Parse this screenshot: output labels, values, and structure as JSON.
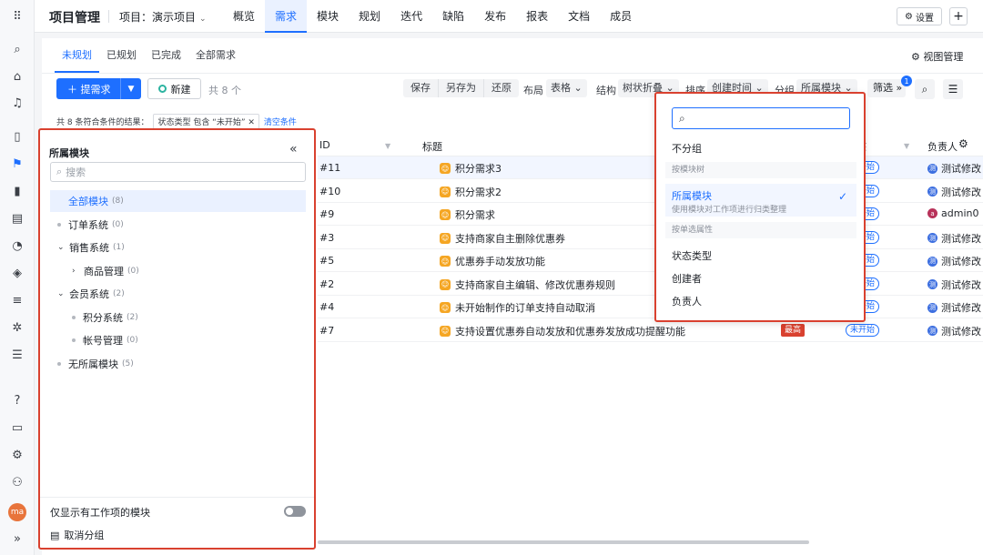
{
  "rail": {
    "icons": [
      "apps-grid-icon",
      "search-icon",
      "home-icon",
      "bell-icon",
      "document-icon",
      "project-icon",
      "chart-icon",
      "knowledge-icon",
      "gauge-icon",
      "cube-icon",
      "test-icon",
      "bug-icon",
      "checklist-icon",
      "help-icon",
      "inbox-icon",
      "gear-icon",
      "add-user-icon"
    ],
    "avatar": "ma",
    "expand": "»"
  },
  "topbar": {
    "app_title": "项目管理",
    "project_label": "项目：演示项目",
    "nav": [
      "概览",
      "需求",
      "模块",
      "规划",
      "迭代",
      "缺陷",
      "发布",
      "报表",
      "文档",
      "成员"
    ],
    "active_nav": "需求",
    "settings_label": "设置",
    "plus_label": "+"
  },
  "subtabs": [
    "未规划",
    "已规划",
    "已完成",
    "全部需求"
  ],
  "view_manage": "视图管理",
  "toolbar": {
    "primary_label": "＋ 提需求",
    "new_label": "新建",
    "count": "共 8 个",
    "seg": [
      "保存",
      "另存为",
      "还原"
    ],
    "layout_label": "布局",
    "layout_value": "表格 ⌄",
    "structure_label": "结构",
    "structure_value": "树状折叠 ⌄",
    "sort_label": "排序",
    "sort_value": "创建时间 ⌄",
    "group_label": "分组",
    "group_value": "所属模块 ⌄",
    "filter_label": "筛选",
    "filter_badge": "1"
  },
  "filter_line": {
    "result_text": "共 8 条符合条件的结果：",
    "chip": "状态类型 包含 “未开始” ✕",
    "clear": "清空条件"
  },
  "module_panel": {
    "title": "所属模块",
    "search_placeholder": "搜索",
    "items": [
      {
        "label": "全部模块",
        "count": "(8)",
        "level": 0,
        "kind": "none",
        "selected": true
      },
      {
        "label": "订单系统",
        "count": "(0)",
        "level": 0,
        "kind": "bullet"
      },
      {
        "label": "销售系统",
        "count": "(1)",
        "level": 0,
        "kind": "open"
      },
      {
        "label": "商品管理",
        "count": "(0)",
        "level": 1,
        "kind": "closed"
      },
      {
        "label": "会员系统",
        "count": "(2)",
        "level": 0,
        "kind": "open"
      },
      {
        "label": "积分系统",
        "count": "(2)",
        "level": 1,
        "kind": "bullet"
      },
      {
        "label": "帐号管理",
        "count": "(0)",
        "level": 1,
        "kind": "bullet"
      },
      {
        "label": "无所属模块",
        "count": "(5)",
        "level": 0,
        "kind": "bullet"
      }
    ],
    "toggle_label": "仅显示有工作项的模块",
    "cancel_group": "取消分组"
  },
  "table": {
    "headers": {
      "id": "ID",
      "title": "标题",
      "status": "态",
      "owner": "负责人"
    },
    "rows": [
      {
        "id": "#11",
        "title": "积分需求3",
        "status": "未开始",
        "owner": "测试修改",
        "owner_avatar": "测",
        "highlight": true
      },
      {
        "id": "#10",
        "title": "积分需求2",
        "status": "未开始",
        "owner": "测试修改",
        "owner_avatar": "测"
      },
      {
        "id": "#9",
        "title": "积分需求",
        "status": "未开始",
        "owner": "admin0",
        "owner_avatar": "a",
        "red": true
      },
      {
        "id": "#3",
        "title": "支持商家自主删除优惠券",
        "status": "未开始",
        "owner": "测试修改",
        "owner_avatar": "测"
      },
      {
        "id": "#5",
        "title": "优惠券手动发放功能",
        "status": "未开始",
        "owner": "测试修改",
        "owner_avatar": "测"
      },
      {
        "id": "#2",
        "title": "支持商家自主编辑、修改优惠券规则",
        "status": "未开始",
        "owner": "测试修改",
        "owner_avatar": "测"
      },
      {
        "id": "#4",
        "title": "未开始制作的订单支持自动取消",
        "status": "未开始",
        "owner": "测试修改",
        "owner_avatar": "测"
      },
      {
        "id": "#7",
        "title": "支持设置优惠券自动发放和优惠券发放成功提醒功能",
        "status": "未开始",
        "owner": "测试修改",
        "owner_avatar": "测",
        "priority": "最高"
      }
    ]
  },
  "group_dropdown": {
    "search_placeholder": "",
    "none": "不分组",
    "section_tree": "按模块树",
    "selected_title": "所属模块",
    "selected_desc": "使用模块对工作项进行归类整理",
    "section_attr": "按单选属性",
    "options": [
      "状态类型",
      "创建者",
      "负责人"
    ]
  }
}
